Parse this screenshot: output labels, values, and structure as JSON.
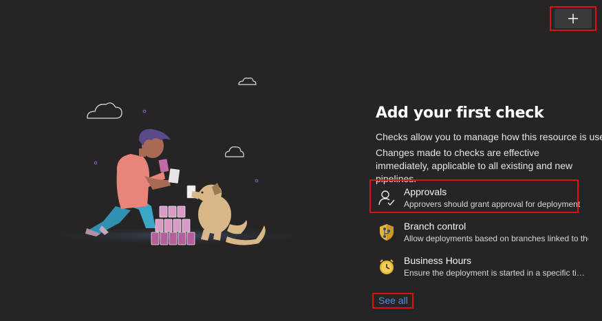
{
  "toolbar": {
    "add_icon": "plus-icon"
  },
  "empty_state": {
    "title": "Add your first check",
    "description_1": "Checks allow you to manage how this resource is used.",
    "description_2": "Changes made to checks are effective immediately, applicable to all existing and new pipelines."
  },
  "checks": [
    {
      "name": "Approvals",
      "description": "Approvers should grant approval for deployment",
      "icon": "person-check-icon"
    },
    {
      "name": "Branch control",
      "description": "Allow deployments based on branches linked to the run",
      "icon": "branch-shield-icon"
    },
    {
      "name": "Business Hours",
      "description": "Ensure the deployment is started in a specific time window",
      "icon": "clock-icon"
    }
  ],
  "see_all_label": "See all",
  "colors": {
    "background": "#262424",
    "highlight": "#e01010",
    "link": "#4f8fe6",
    "shield": "#e3b53a",
    "clock": "#e8b83a"
  }
}
